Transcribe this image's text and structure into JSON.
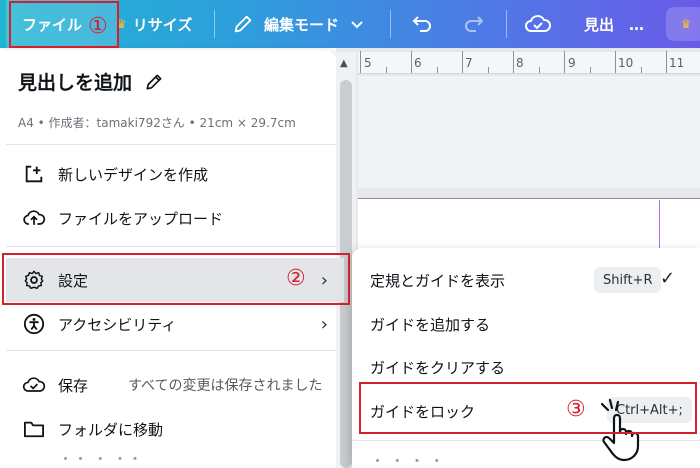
{
  "topbar": {
    "file": "ファイル",
    "resize": "リサイズ",
    "edit_mode": "編集モード",
    "title": "見出　…"
  },
  "annotations": {
    "one": "①",
    "two": "②",
    "three": "③"
  },
  "ruler": {
    "ticks": [
      "5",
      "6",
      "7",
      "8",
      "9",
      "10",
      "11"
    ]
  },
  "menu": {
    "title": "見出しを追加",
    "subtitle": "A4 • 作成者：tamaki792さん • 21cm × 29.7cm",
    "new_design": "新しいデザインを作成",
    "upload": "ファイルをアップロード",
    "settings": "設定",
    "accessibility": "アクセシビリティ",
    "save": "保存",
    "save_status": "すべての変更は保存されました",
    "move_folder": "フォルダに移動",
    "partial": "・・ ・ ・・"
  },
  "submenu": {
    "show_rulers": "定規とガイドを表示",
    "show_rulers_shortcut": "Shift+R",
    "add_guide": "ガイドを追加する",
    "clear_guides": "ガイドをクリアする",
    "lock_guides": "ガイドをロック",
    "lock_guides_shortcut": "Ctrl+Alt+;",
    "partial": "・ ・ ・ ・"
  },
  "colors": {
    "annotation_red": "#d4202c",
    "guide": "#a874e8"
  },
  "icons": {
    "pencil": "pencil-icon",
    "add": "add-design-icon",
    "upload": "cloud-upload-icon",
    "settings": "gear-icon",
    "accessibility": "accessibility-icon",
    "save": "cloud-check-icon",
    "folder": "folder-icon",
    "undo": "undo-icon",
    "redo": "redo-icon",
    "crown": "crown-icon",
    "check": "check-icon",
    "hand": "hand-pointer-icon"
  }
}
